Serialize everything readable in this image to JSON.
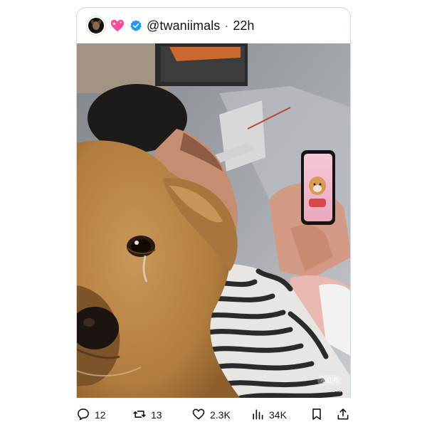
{
  "post": {
    "handle": "@twaniimals",
    "separator": "·",
    "time": "22h",
    "avatar_icon": "profile-avatar",
    "emoji_icon": "sparkling-heart-icon",
    "verified_icon": "verified-badge-icon",
    "verified_color": "#1d9bf0"
  },
  "media": {
    "watermark_logo": "小红书",
    "watermark_text": "rednote ID：zx15840966466"
  },
  "actions": {
    "replies": "12",
    "reposts": "13",
    "likes": "2.3K",
    "views": "34K"
  },
  "colors": {
    "text": "#0f1419",
    "muted": "#536471",
    "border": "#cfd9de"
  }
}
